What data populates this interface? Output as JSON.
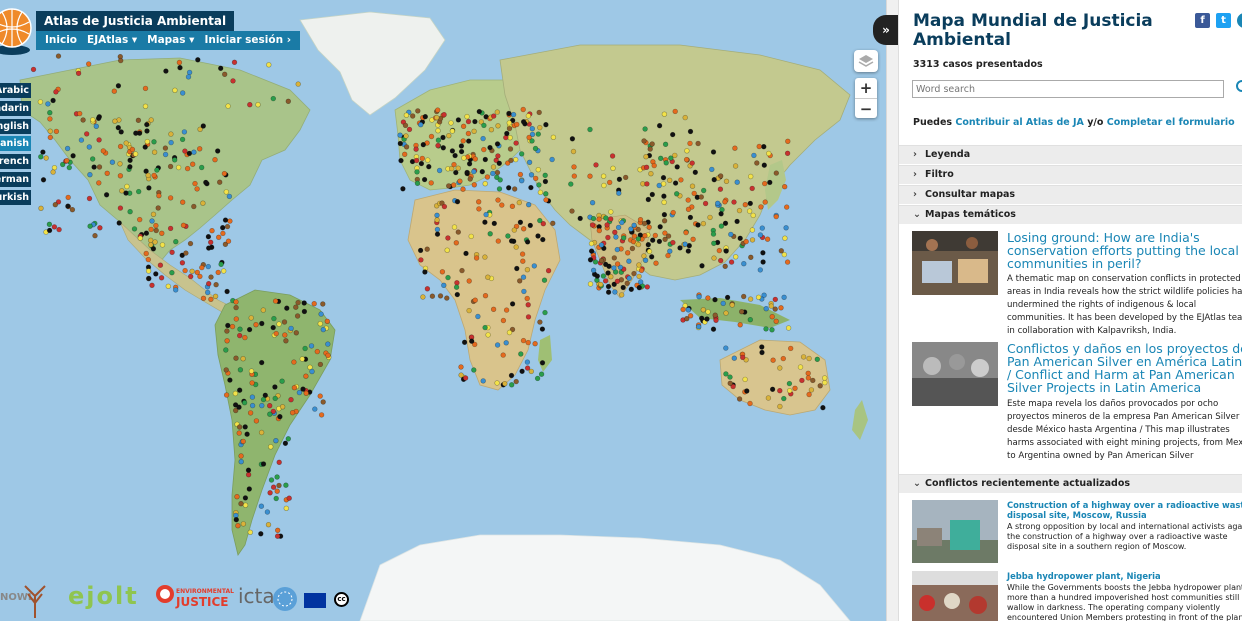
{
  "map": {
    "title": "Atlas de Justicia Ambiental",
    "nav": [
      "Inicio",
      "EJAtlas ▾",
      "Mapas ▾",
      "Iniciar sesión ›"
    ],
    "languages": [
      {
        "label": "Arabic",
        "active": false
      },
      {
        "label": "Mandarin",
        "active": false
      },
      {
        "label": "English",
        "active": false
      },
      {
        "label": "Spanish",
        "active": true
      },
      {
        "label": "French",
        "active": false
      },
      {
        "label": "German",
        "active": false
      },
      {
        "label": "Turkish",
        "active": false
      }
    ],
    "zoom_in": "+",
    "zoom_out": "−",
    "collapse_label": "»",
    "icons": [
      "globe-logo-icon",
      "layers-icon",
      "fast-forward-icon",
      "search-icon",
      "facebook-icon",
      "twitter-icon"
    ]
  },
  "footer_logos": {
    "nowl": "NOWL",
    "ejolt": "ejolt",
    "ej_line1": "ENVIRONMENTAL",
    "ej_line2": "JUSTICE",
    "icta": "icta",
    "cc": "cc"
  },
  "panel": {
    "title": "Mapa Mundial de Justicia Ambiental",
    "facebook": "f",
    "twitter": "t",
    "cases": "3313 casos presentados",
    "search_placeholder": "Word search",
    "contrib_prefix": "Puedes",
    "contrib_link1": "Contribuir al Atlas de JA",
    "contrib_mid": "y/o",
    "contrib_link2": "Completar el formulario",
    "sections": [
      {
        "label": "Leyenda",
        "open": false
      },
      {
        "label": "Filtro",
        "open": false
      },
      {
        "label": "Consultar mapas",
        "open": false
      },
      {
        "label": "Mapas temáticos",
        "open": true
      }
    ],
    "featured": [
      {
        "title": "Losing ground: How are India's conservation efforts putting the local communities in peril?",
        "desc": "A thematic map on conservation conflicts in protected areas in India reveals how the strict wildlife policies have undermined the rights of indigenous & local communities. It has been developed by the EJAtlas team in collaboration with Kalpavriksh, India."
      },
      {
        "title": "Conflictos y daños en los proyectos de Pan American Silver en América Latina / Conflict and Harm at Pan American Silver Projects in Latin America",
        "desc": "Este mapa revela los daños provocados por ocho proyectos mineros de la empresa Pan American Silver desde México hasta Argentina / This map illustrates harms associated with eight mining projects, from Mexico to Argentina owned by Pan American Silver"
      }
    ],
    "recent_header": "Conflictos recientemente actualizados",
    "recent": [
      {
        "title": "Construction of a highway over a radioactive waste disposal site, Moscow, Russia",
        "desc": "A strong opposition by local and international activists against the construction of a highway over a radioactive waste disposal site in a southern region of Moscow."
      },
      {
        "title": "Jebba hydropower plant, Nigeria",
        "desc": "While the Governments boosts the Jebba hydropower plant, more than a hundred impoverished host communities still wallow in darkness. The operating company violently encountered Union Members protesting in front of the plant."
      }
    ]
  }
}
